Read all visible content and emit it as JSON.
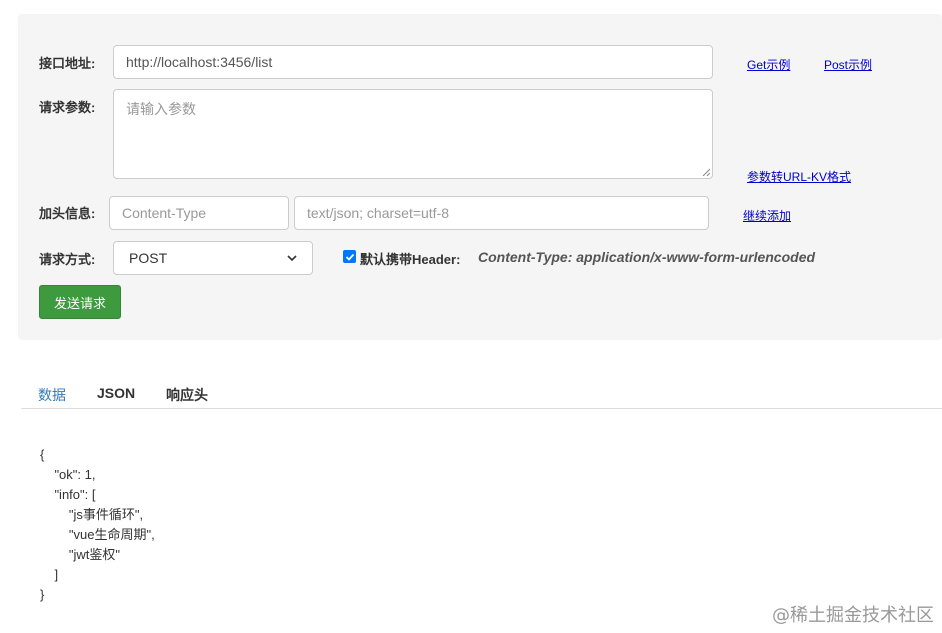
{
  "form": {
    "url_label": "接口地址:",
    "url_value": "http://localhost:3456/list",
    "params_label": "请求参数:",
    "params_placeholder": "请输入参数",
    "header_label": "加头信息:",
    "header_key_placeholder": "Content-Type",
    "header_value_placeholder": "text/json; charset=utf-8",
    "method_label": "请求方式:",
    "method_value": "POST",
    "default_header_label": "默认携带Header:",
    "default_header_value": "Content-Type: application/x-www-form-urlencoded",
    "default_header_checked": true,
    "send_button": "发送请求"
  },
  "links": {
    "get_example": "Get示例",
    "post_example": "Post示例",
    "params_to_urlkv": "参数转URL-KV格式",
    "add_more": "继续添加"
  },
  "tabs": [
    {
      "label": "数据",
      "active": true
    },
    {
      "label": "JSON",
      "active": false
    },
    {
      "label": "响应头",
      "active": false
    }
  ],
  "response": {
    "lines": [
      "{",
      "    \"ok\": 1,",
      "    \"info\": [",
      "        \"js事件循环\",",
      "        \"vue生命周期\",",
      "        \"jwt鉴权\"",
      "    ]",
      "}"
    ]
  },
  "watermark": "@稀土掘金技术社区",
  "colors": {
    "panel_bg": "#f5f5f5",
    "button_green": "#3e9a3e",
    "link_blue": "#0000cc",
    "active_tab": "#337ab7",
    "checkbox_blue": "#0075ff"
  }
}
